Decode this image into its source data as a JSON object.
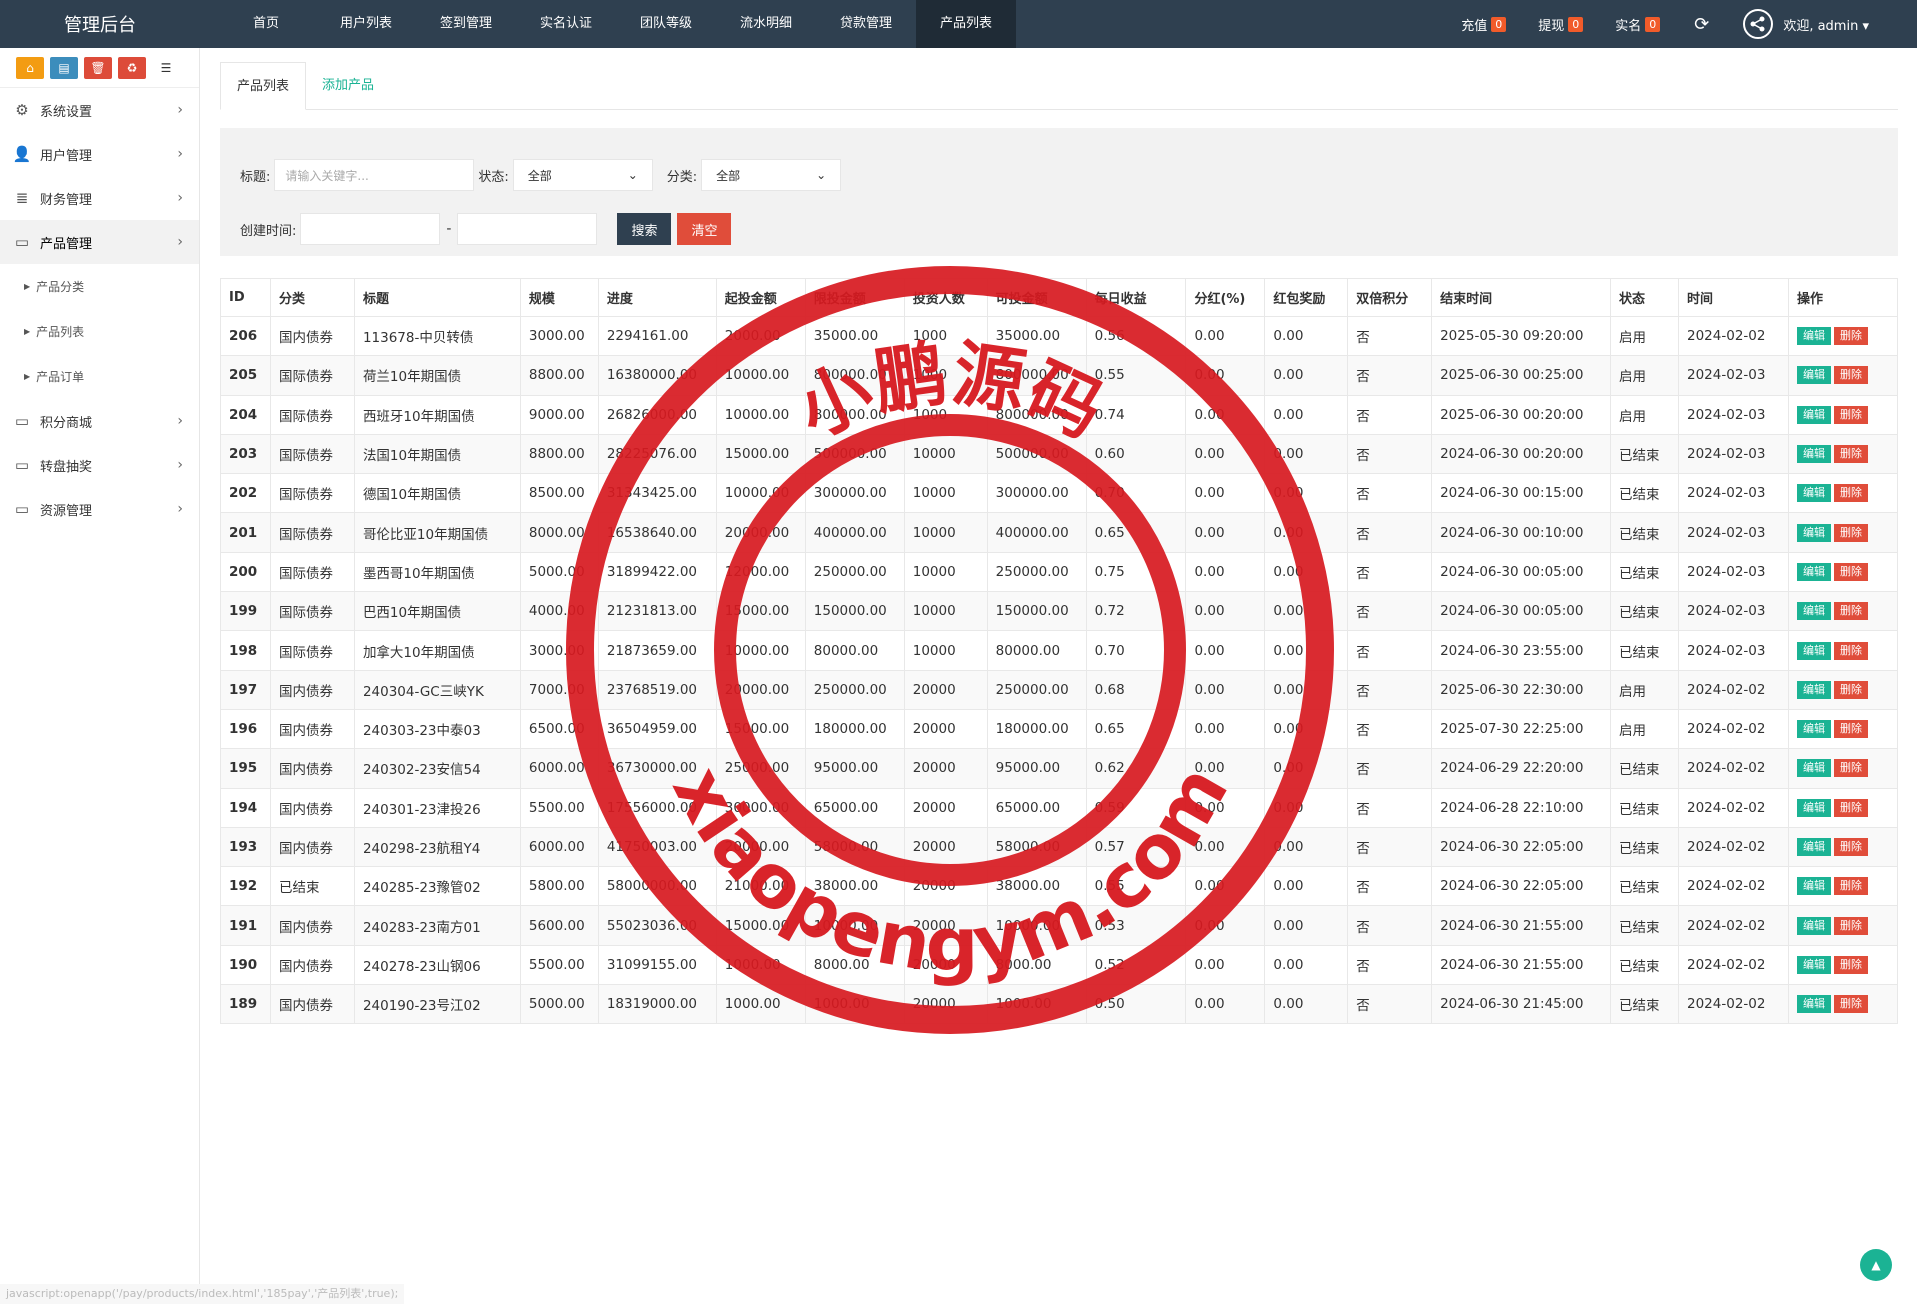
{
  "app": {
    "title": "管理后台"
  },
  "nav": [
    "首页",
    "用户列表",
    "签到管理",
    "实名认证",
    "团队等级",
    "流水明细",
    "贷款管理",
    "产品列表"
  ],
  "topright": {
    "recharge": "充值",
    "recharge_count": "0",
    "withdraw": "提现",
    "withdraw_count": "0",
    "realname": "实名",
    "realname_count": "0",
    "welcome": "欢迎, admin"
  },
  "sidebar": {
    "quick_buttons": [
      {
        "icon": "home-icon",
        "color": "#f39c12"
      },
      {
        "icon": "file-icon",
        "color": "#3c8dbc"
      },
      {
        "icon": "trash-icon",
        "color": "#dd4b39"
      },
      {
        "icon": "refresh-icon",
        "color": "#dd4b39"
      },
      {
        "icon": "list-icon",
        "color": "#ffffff"
      }
    ],
    "items": [
      {
        "label": "系统设置",
        "icon": "gears-icon"
      },
      {
        "label": "用户管理",
        "icon": "user-icon"
      },
      {
        "label": "财务管理",
        "icon": "database-icon"
      },
      {
        "label": "产品管理",
        "icon": "monitor-icon"
      },
      {
        "label": "积分商城",
        "icon": "monitor-icon"
      },
      {
        "label": "转盘抽奖",
        "icon": "monitor-icon"
      },
      {
        "label": "资源管理",
        "icon": "monitor-icon"
      }
    ],
    "subitems": [
      "产品分类",
      "产品列表",
      "产品订单"
    ]
  },
  "tabs": [
    "产品列表",
    "添加产品"
  ],
  "filter": {
    "title_label": "标题:",
    "title_placeholder": "请输入关键字...",
    "status_label": "状态:",
    "status_value": "全部",
    "category_label": "分类:",
    "category_value": "全部",
    "created_label": "创建时间:",
    "dash": "-",
    "search_btn": "搜索",
    "clear_btn": "清空"
  },
  "table": {
    "headers": [
      "ID",
      "分类",
      "标题",
      "规模",
      "进度",
      "起投金额",
      "限投金额",
      "投资人数",
      "可投金额",
      "每日收益",
      "分红(%)",
      "红包奖励",
      "双倍积分",
      "结束时间",
      "状态",
      "时间",
      "操作"
    ],
    "edit_label": "编辑",
    "delete_label": "删除",
    "rows": [
      [
        "206",
        "国内债券",
        "113678-中贝转债",
        "3000.00",
        "2294161.00",
        "2000.00",
        "35000.00",
        "1000",
        "35000.00",
        "0.56",
        "0.00",
        "0.00",
        "否",
        "2025-05-30 09:20:00",
        "启用",
        "2024-02-02"
      ],
      [
        "205",
        "国际债券",
        "荷兰10年期国债",
        "8800.00",
        "16380000.00",
        "10000.00",
        "800000.00",
        "1000",
        "800000.00",
        "0.55",
        "0.00",
        "0.00",
        "否",
        "2025-06-30 00:25:00",
        "启用",
        "2024-02-03"
      ],
      [
        "204",
        "国际债券",
        "西班牙10年期国债",
        "9000.00",
        "26826000.00",
        "10000.00",
        "800000.00",
        "1000",
        "800000.00",
        "0.74",
        "0.00",
        "0.00",
        "否",
        "2025-06-30 00:20:00",
        "启用",
        "2024-02-03"
      ],
      [
        "203",
        "国际债券",
        "法国10年期国债",
        "8800.00",
        "28225076.00",
        "15000.00",
        "500000.00",
        "10000",
        "500000.00",
        "0.60",
        "0.00",
        "0.00",
        "否",
        "2024-06-30 00:20:00",
        "已结束",
        "2024-02-03"
      ],
      [
        "202",
        "国际债券",
        "德国10年期国债",
        "8500.00",
        "31343425.00",
        "10000.00",
        "300000.00",
        "10000",
        "300000.00",
        "0.70",
        "0.00",
        "0.00",
        "否",
        "2024-06-30 00:15:00",
        "已结束",
        "2024-02-03"
      ],
      [
        "201",
        "国际债券",
        "哥伦比亚10年期国债",
        "8000.00",
        "16538640.00",
        "20000.00",
        "400000.00",
        "10000",
        "400000.00",
        "0.65",
        "0.00",
        "0.00",
        "否",
        "2024-06-30 00:10:00",
        "已结束",
        "2024-02-03"
      ],
      [
        "200",
        "国际债券",
        "墨西哥10年期国债",
        "5000.00",
        "31899422.00",
        "12000.00",
        "250000.00",
        "10000",
        "250000.00",
        "0.75",
        "0.00",
        "0.00",
        "否",
        "2024-06-30 00:05:00",
        "已结束",
        "2024-02-03"
      ],
      [
        "199",
        "国际债券",
        "巴西10年期国债",
        "4000.00",
        "21231813.00",
        "15000.00",
        "150000.00",
        "10000",
        "150000.00",
        "0.72",
        "0.00",
        "0.00",
        "否",
        "2024-06-30 00:05:00",
        "已结束",
        "2024-02-03"
      ],
      [
        "198",
        "国际债券",
        "加拿大10年期国债",
        "3000.00",
        "21873659.00",
        "10000.00",
        "80000.00",
        "10000",
        "80000.00",
        "0.70",
        "0.00",
        "0.00",
        "否",
        "2024-06-30 23:55:00",
        "已结束",
        "2024-02-03"
      ],
      [
        "197",
        "国内债券",
        "240304-GC三峡YK",
        "7000.00",
        "23768519.00",
        "20000.00",
        "250000.00",
        "20000",
        "250000.00",
        "0.68",
        "0.00",
        "0.00",
        "否",
        "2025-06-30 22:30:00",
        "启用",
        "2024-02-02"
      ],
      [
        "196",
        "国内债券",
        "240303-23中泰03",
        "6500.00",
        "36504959.00",
        "15000.00",
        "180000.00",
        "20000",
        "180000.00",
        "0.65",
        "0.00",
        "0.00",
        "否",
        "2025-07-30 22:25:00",
        "启用",
        "2024-02-02"
      ],
      [
        "195",
        "国内债券",
        "240302-23安信54",
        "6000.00",
        "36730000.00",
        "25000.00",
        "95000.00",
        "20000",
        "95000.00",
        "0.62",
        "0.00",
        "0.00",
        "否",
        "2024-06-29 22:20:00",
        "已结束",
        "2024-02-02"
      ],
      [
        "194",
        "国内债券",
        "240301-23津投26",
        "5500.00",
        "17556000.00",
        "30000.00",
        "65000.00",
        "20000",
        "65000.00",
        "0.59",
        "0.00",
        "0.00",
        "否",
        "2024-06-28 22:10:00",
        "已结束",
        "2024-02-02"
      ],
      [
        "193",
        "国内债券",
        "240298-23航租Y4",
        "6000.00",
        "41750003.00",
        "20000.00",
        "58000.00",
        "20000",
        "58000.00",
        "0.57",
        "0.00",
        "0.00",
        "否",
        "2024-06-30 22:05:00",
        "已结束",
        "2024-02-02"
      ],
      [
        "192",
        "已结束",
        "240285-23豫管02",
        "5800.00",
        "58000000.00",
        "21000.00",
        "38000.00",
        "20000",
        "38000.00",
        "0.55",
        "0.00",
        "0.00",
        "否",
        "2024-06-30 22:05:00",
        "已结束",
        "2024-02-02"
      ],
      [
        "191",
        "国内债券",
        "240283-23南方01",
        "5600.00",
        "55023036.00",
        "15000.00",
        "10000.00",
        "20000",
        "10000.00",
        "0.53",
        "0.00",
        "0.00",
        "否",
        "2024-06-30 21:55:00",
        "已结束",
        "2024-02-02"
      ],
      [
        "190",
        "国内债券",
        "240278-23山钢06",
        "5500.00",
        "31099155.00",
        "1000.00",
        "8000.00",
        "20000",
        "8000.00",
        "0.52",
        "0.00",
        "0.00",
        "否",
        "2024-06-30 21:55:00",
        "已结束",
        "2024-02-02"
      ],
      [
        "189",
        "国内债券",
        "240190-23号江02",
        "5000.00",
        "18319000.00",
        "1000.00",
        "1000.00",
        "20000",
        "1000.00",
        "0.50",
        "0.00",
        "0.00",
        "否",
        "2024-06-30 21:45:00",
        "已结束",
        "2024-02-02"
      ]
    ]
  },
  "statusbar": "javascript:openapp('/pay/products/index.html','185pay','产品列表',true);",
  "watermark": {
    "top_text": "小鹏源码",
    "bottom_text": "xiaopengym.com",
    "color": "#d7191f"
  }
}
